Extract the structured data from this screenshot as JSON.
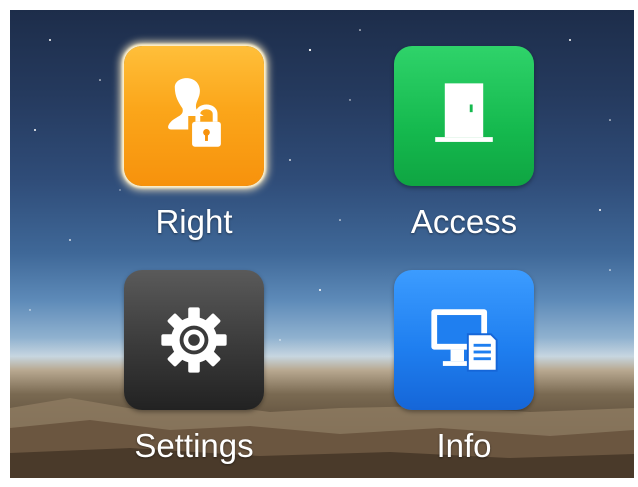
{
  "menu": {
    "items": [
      {
        "label": "Right",
        "icon": "user-lock-icon",
        "color": "#fba61a",
        "selected": true
      },
      {
        "label": "Access",
        "icon": "door-icon",
        "color": "#15b94e",
        "selected": false
      },
      {
        "label": "Settings",
        "icon": "gear-icon",
        "color": "#3a3a3a",
        "selected": false
      },
      {
        "label": "Info",
        "icon": "monitor-document-icon",
        "color": "#1f7ff0",
        "selected": false
      }
    ]
  }
}
